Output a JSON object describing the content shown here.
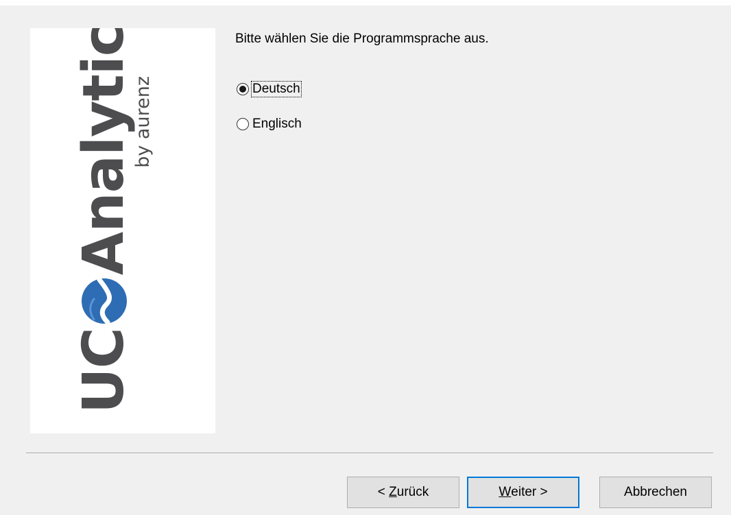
{
  "logo": {
    "main_left": "UC",
    "main_right": "Analytics",
    "sub": "by aurenz"
  },
  "prompt": "Bitte wählen Sie die Programmsprache aus.",
  "options": [
    {
      "label": "Deutsch",
      "selected": true
    },
    {
      "label": "Englisch",
      "selected": false
    }
  ],
  "buttons": {
    "back": {
      "prefix": "< ",
      "mnemonic": "Z",
      "rest": "urück"
    },
    "next": {
      "mnemonic": "W",
      "rest": "eiter >"
    },
    "cancel": {
      "label": "Abbrechen"
    }
  },
  "colors": {
    "dialog_bg": "#f0f0f0",
    "logo_gray": "#4d4d4f",
    "logo_blue": "#2e6db4",
    "default_button_border": "#0078d7"
  }
}
